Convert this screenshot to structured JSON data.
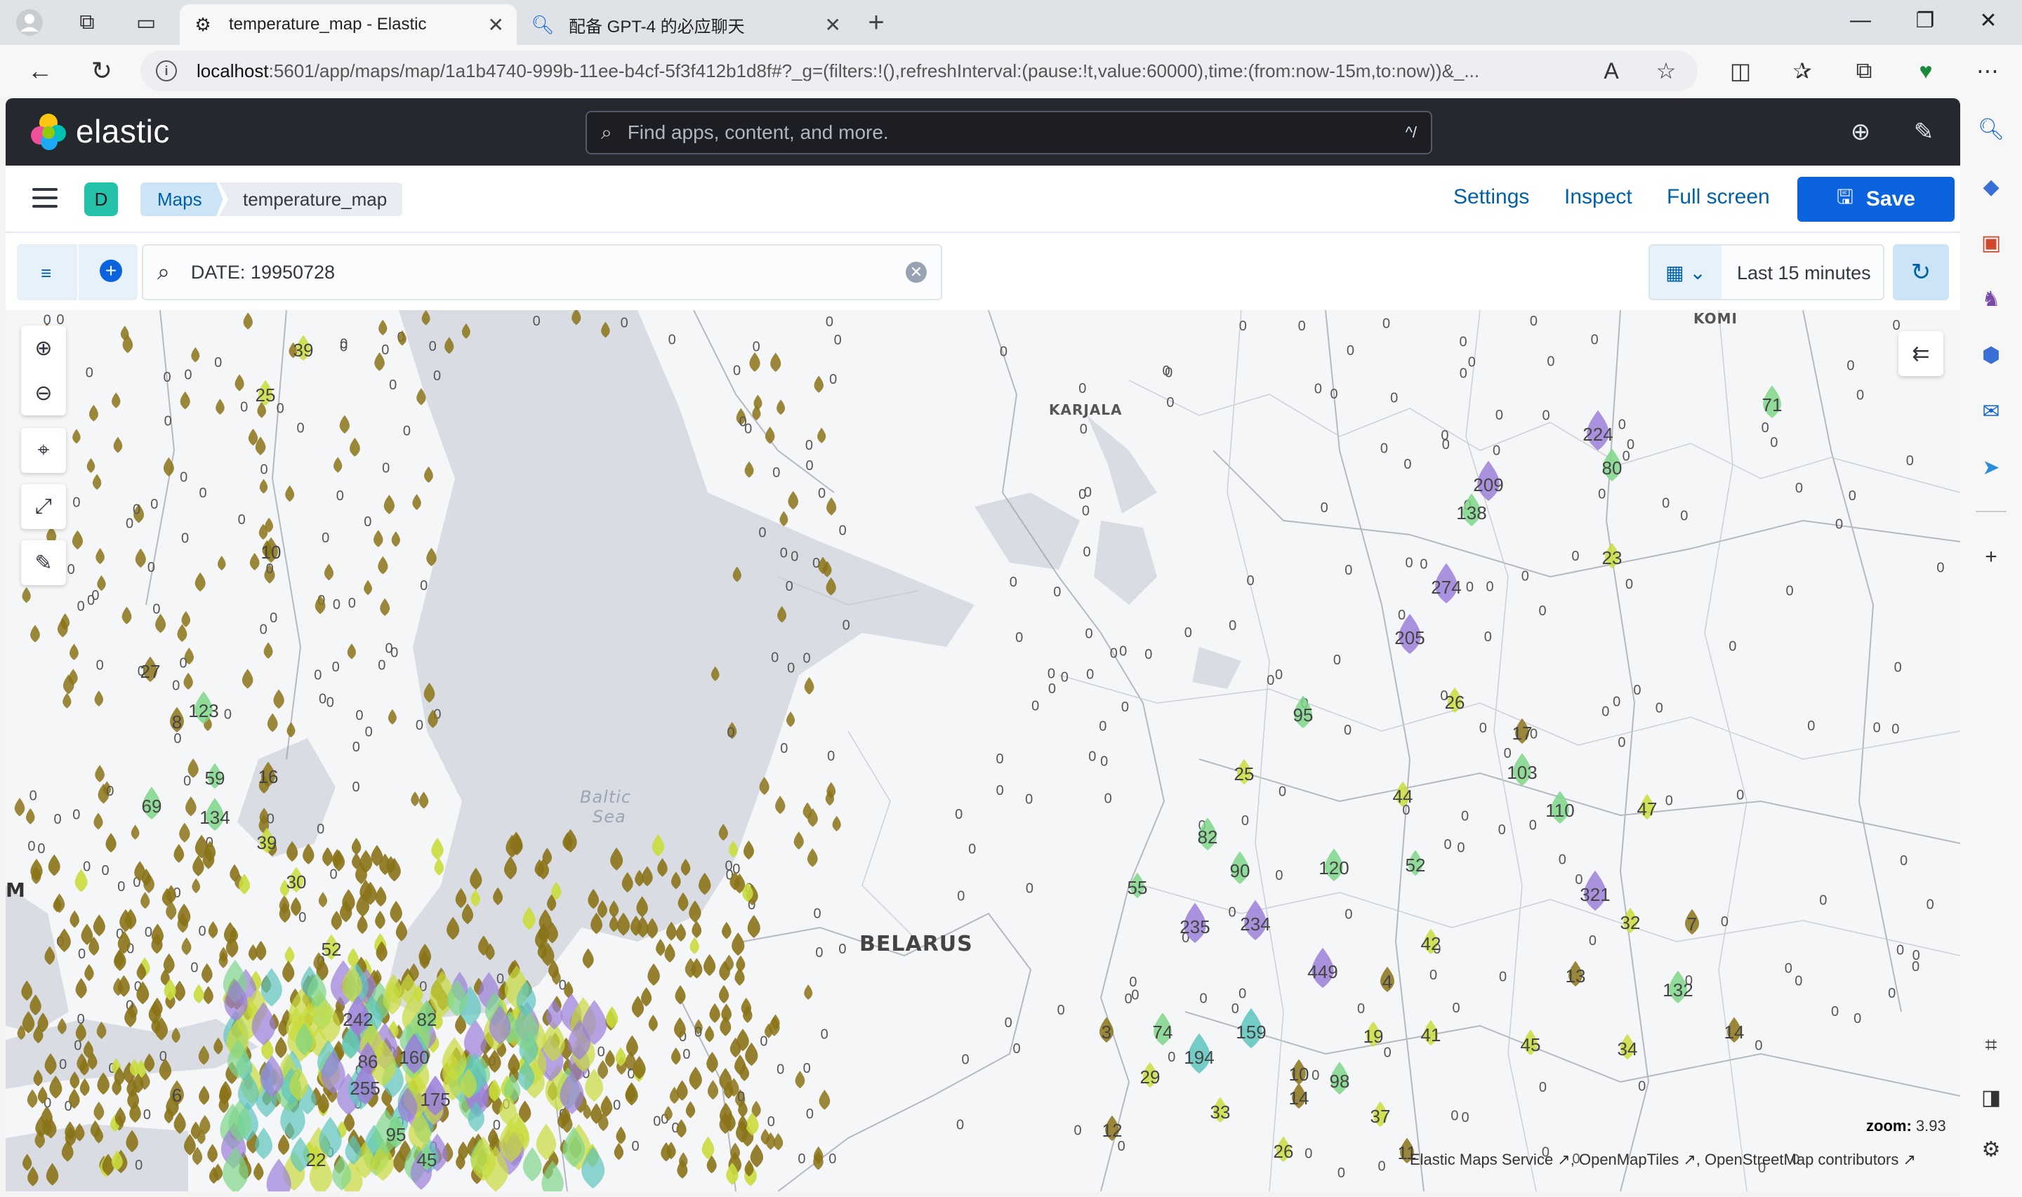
{
  "browser": {
    "tabs": [
      {
        "title": "temperature_map - Elastic"
      },
      {
        "title": "配备 GPT-4 的必应聊天"
      }
    ],
    "url_host": "localhost",
    "url_rest": ":5601/app/maps/map/1a1b4740-999b-11ee-b4cf-5f3f412b1d8f#?_g=(filters:!(),refreshInterval:(pause:!t,value:60000),time:(from:now-15m,to:now))&_..."
  },
  "header": {
    "brand": "elastic",
    "search_placeholder": "Find apps, content, and more.",
    "search_shortcut": "^/"
  },
  "toolbar": {
    "space_initial": "D",
    "breadcrumbs": [
      "Maps",
      "temperature_map"
    ],
    "settings": "Settings",
    "inspect": "Inspect",
    "full_screen": "Full screen",
    "save": "Save"
  },
  "query": {
    "value": "DATE: 19950728",
    "time_range": "Last 15 minutes"
  },
  "map": {
    "labels": {
      "komi": "KOMI",
      "karjala": "KARJALA",
      "belarus": "BELARUS",
      "baltic1": "Baltic",
      "baltic2": "Sea",
      "m": "M"
    },
    "zoom_label": "zoom:",
    "zoom_value": "3.93",
    "attribution": [
      "Elastic Maps Service",
      "OpenMapTiles",
      "OpenStreetMap contributors"
    ],
    "colors": {
      "low": "#8a7318",
      "mid": "#c9dc3c",
      "green": "#7fd68a",
      "teal": "#5cc4bd",
      "purple": "#9b7fd9"
    },
    "markers": [
      {
        "value": "39",
        "c": "mid"
      },
      {
        "value": "25",
        "c": "mid"
      },
      {
        "value": "27",
        "c": "low"
      },
      {
        "value": "123",
        "c": "green"
      },
      {
        "value": "59",
        "c": "green"
      },
      {
        "value": "134",
        "c": "green"
      },
      {
        "value": "69",
        "c": "green"
      },
      {
        "value": "39",
        "c": "mid"
      },
      {
        "value": "30",
        "c": "mid"
      },
      {
        "value": "52",
        "c": "mid"
      },
      {
        "value": "242",
        "c": "purple"
      },
      {
        "value": "82",
        "c": "green"
      },
      {
        "value": "86",
        "c": "purple"
      },
      {
        "value": "160",
        "c": "purple"
      },
      {
        "value": "255",
        "c": "purple"
      },
      {
        "value": "175",
        "c": "purple"
      },
      {
        "value": "95",
        "c": "green"
      },
      {
        "value": "45",
        "c": "green"
      },
      {
        "value": "22",
        "c": "mid"
      },
      {
        "value": "10",
        "c": "low"
      },
      {
        "value": "224",
        "c": "purple"
      },
      {
        "value": "80",
        "c": "green"
      },
      {
        "value": "209",
        "c": "purple"
      },
      {
        "value": "138",
        "c": "green"
      },
      {
        "value": "71",
        "c": "green"
      },
      {
        "value": "274",
        "c": "purple"
      },
      {
        "value": "205",
        "c": "purple"
      },
      {
        "value": "23",
        "c": "mid"
      },
      {
        "value": "95",
        "c": "green"
      },
      {
        "value": "26",
        "c": "mid"
      },
      {
        "value": "17",
        "c": "low"
      },
      {
        "value": "103",
        "c": "green"
      },
      {
        "value": "25",
        "c": "mid"
      },
      {
        "value": "44",
        "c": "mid"
      },
      {
        "value": "110",
        "c": "green"
      },
      {
        "value": "47",
        "c": "mid"
      },
      {
        "value": "82",
        "c": "green"
      },
      {
        "value": "90",
        "c": "green"
      },
      {
        "value": "120",
        "c": "green"
      },
      {
        "value": "52",
        "c": "green"
      },
      {
        "value": "321",
        "c": "purple"
      },
      {
        "value": "55",
        "c": "green"
      },
      {
        "value": "235",
        "c": "purple"
      },
      {
        "value": "234",
        "c": "purple"
      },
      {
        "value": "32",
        "c": "mid"
      },
      {
        "value": "42",
        "c": "mid"
      },
      {
        "value": "449",
        "c": "purple"
      },
      {
        "value": "132",
        "c": "green"
      },
      {
        "value": "74",
        "c": "green"
      },
      {
        "value": "159",
        "c": "teal"
      },
      {
        "value": "194",
        "c": "teal"
      },
      {
        "value": "19",
        "c": "mid"
      },
      {
        "value": "41",
        "c": "mid"
      },
      {
        "value": "45",
        "c": "mid"
      },
      {
        "value": "34",
        "c": "mid"
      },
      {
        "value": "14",
        "c": "low"
      },
      {
        "value": "29",
        "c": "mid"
      },
      {
        "value": "10",
        "c": "low"
      },
      {
        "value": "98",
        "c": "green"
      },
      {
        "value": "33",
        "c": "mid"
      },
      {
        "value": "14",
        "c": "low"
      },
      {
        "value": "37",
        "c": "mid"
      },
      {
        "value": "26",
        "c": "mid"
      },
      {
        "value": "12",
        "c": "low"
      },
      {
        "value": "3",
        "c": "low"
      },
      {
        "value": "11",
        "c": "low"
      },
      {
        "value": "16",
        "c": "low"
      },
      {
        "value": "13",
        "c": "low"
      },
      {
        "value": "6",
        "c": "low"
      },
      {
        "value": "4",
        "c": "low"
      },
      {
        "value": "7",
        "c": "low"
      },
      {
        "value": "8",
        "c": "low"
      }
    ]
  }
}
